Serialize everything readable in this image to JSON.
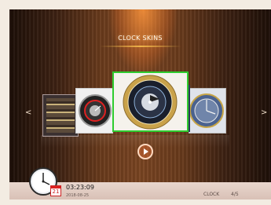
{
  "header": {
    "title": "CLOCK  SKINS"
  },
  "navigation": {
    "prev_icon": "chevron-left",
    "prev_label": "<",
    "next_icon": "chevron-right",
    "next_label": ">"
  },
  "carousel": {
    "skins": [
      {
        "name": "skin-1"
      },
      {
        "name": "skin-2"
      },
      {
        "name": "skin-3",
        "selected": true
      },
      {
        "name": "skin-4"
      },
      {
        "name": "skin-5"
      }
    ]
  },
  "controls": {
    "play_icon": "play-icon"
  },
  "status": {
    "time": "03:23:09",
    "date": "2018-08-25",
    "calendar_day": "21",
    "mode": "CLOCK",
    "page": "4/5"
  },
  "colors": {
    "selection_border": "#2ecc2e",
    "accent_glow": "#ff9a3c"
  }
}
